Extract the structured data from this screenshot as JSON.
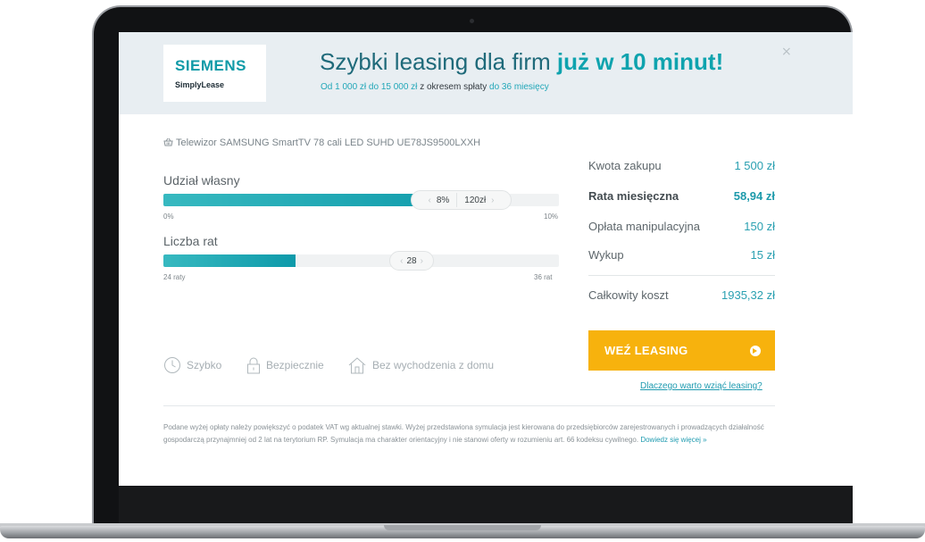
{
  "brand": {
    "logo_main": "SIEMENS",
    "logo_sub": "SimplyLease"
  },
  "header": {
    "headline_prefix": "Szybki leasing dla firm ",
    "headline_highlight": "już w 10 minut!",
    "sub_amount": "Od 1 000 zł do 15 000 zł",
    "sub_middle": " z okresem spłaty ",
    "sub_period": "do 36 miesięcy",
    "close_label": "×"
  },
  "product": {
    "icon": "shopping-basket-icon",
    "name": "Telewizor SAMSUNG SmartTV 78 cali LED SUHD UE78JS9500LXXH"
  },
  "down_payment": {
    "label": "Udział własny",
    "percent_label": "8%",
    "amount_label": "120zł",
    "min_label": "0%",
    "max_label": "10%",
    "value_percent": 8,
    "min": 0,
    "max": 10
  },
  "installments": {
    "label": "Liczba rat",
    "value_label": "28",
    "min_label": "24 raty",
    "max_label": "36 rat",
    "value": 28,
    "min": 24,
    "max": 36
  },
  "arrows": {
    "left": "‹",
    "right": "›"
  },
  "summary": {
    "purchase_amount_label": "Kwota zakupu",
    "purchase_amount_value": "1 500 zł",
    "monthly_rate_label": "Rata miesięczna",
    "monthly_rate_value": "58,94 zł",
    "handling_fee_label": "Opłata manipulacyjna",
    "handling_fee_value": "150 zł",
    "buyout_label": "Wykup",
    "buyout_value": "15 zł",
    "total_cost_label": "Całkowity koszt",
    "total_cost_value": "1935,32 zł"
  },
  "cta": {
    "label": "WEŹ LEASING",
    "icon": "arrow-right-circle-icon"
  },
  "why_link": "Dlaczego warto wziąć leasing?",
  "features": [
    {
      "icon": "clock-icon",
      "label": "Szybko"
    },
    {
      "icon": "lock-icon",
      "label": "Bezpiecznie"
    },
    {
      "icon": "house-icon",
      "label": "Bez wychodzenia z domu"
    }
  ],
  "disclaimer": {
    "text": "Podane wyżej opłaty należy powiększyć o podatek VAT wg aktualnej stawki. Wyżej przedstawiona symulacja jest kierowana do przedsiębiorców zarejestrowanych i prowadzących działalność gospodarczą przynajmniej od 2 lat na terytorium RP. Symulacja ma charakter orientacyjny i nie stanowi oferty w rozumieniu art. 66 kodeksu cywilnego. ",
    "link": "Dowiedz się więcej »"
  },
  "colors": {
    "accent_teal": "#0fa3ae",
    "cta_yellow": "#f7b20d",
    "header_bg": "#e8eef2"
  }
}
